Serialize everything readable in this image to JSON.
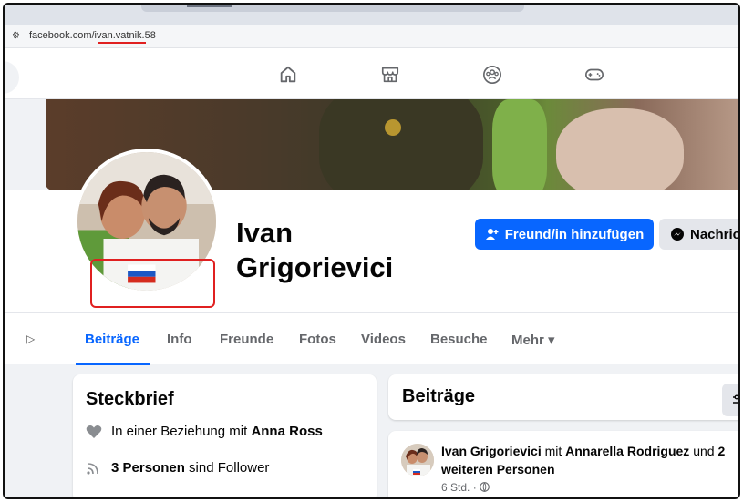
{
  "browser": {
    "url_prefix": "facebook.com/",
    "url_handle": "ivan.vatnik.58"
  },
  "nav": {
    "icons": [
      "home-icon",
      "marketplace-icon",
      "groups-icon",
      "gaming-icon"
    ]
  },
  "profile": {
    "name_line1": "Ivan",
    "name_line2": "Grigorievici",
    "add_friend_label": "Freund/in hinzufügen",
    "message_label": "Nachrich"
  },
  "tabs": [
    {
      "label": "Beiträge",
      "active": true
    },
    {
      "label": "Info"
    },
    {
      "label": "Freunde"
    },
    {
      "label": "Fotos"
    },
    {
      "label": "Videos"
    },
    {
      "label": "Besuche"
    },
    {
      "label": "Mehr ▾"
    }
  ],
  "intro": {
    "title": "Steckbrief",
    "relationship_prefix": "In einer Beziehung mit",
    "relationship_name": "Anna Ross",
    "followers_count": "3 Personen",
    "followers_suffix": "sind Follower"
  },
  "posts": {
    "title": "Beiträge",
    "author": "Ivan Grigorievici",
    "with_word": "mit",
    "tagged": "Annarella Rodriguez",
    "and_word": "und",
    "others": "2 weiteren Personen",
    "time": "6 Std. ·"
  },
  "colors": {
    "accent": "#0866ff",
    "highlight": "#e02020"
  }
}
